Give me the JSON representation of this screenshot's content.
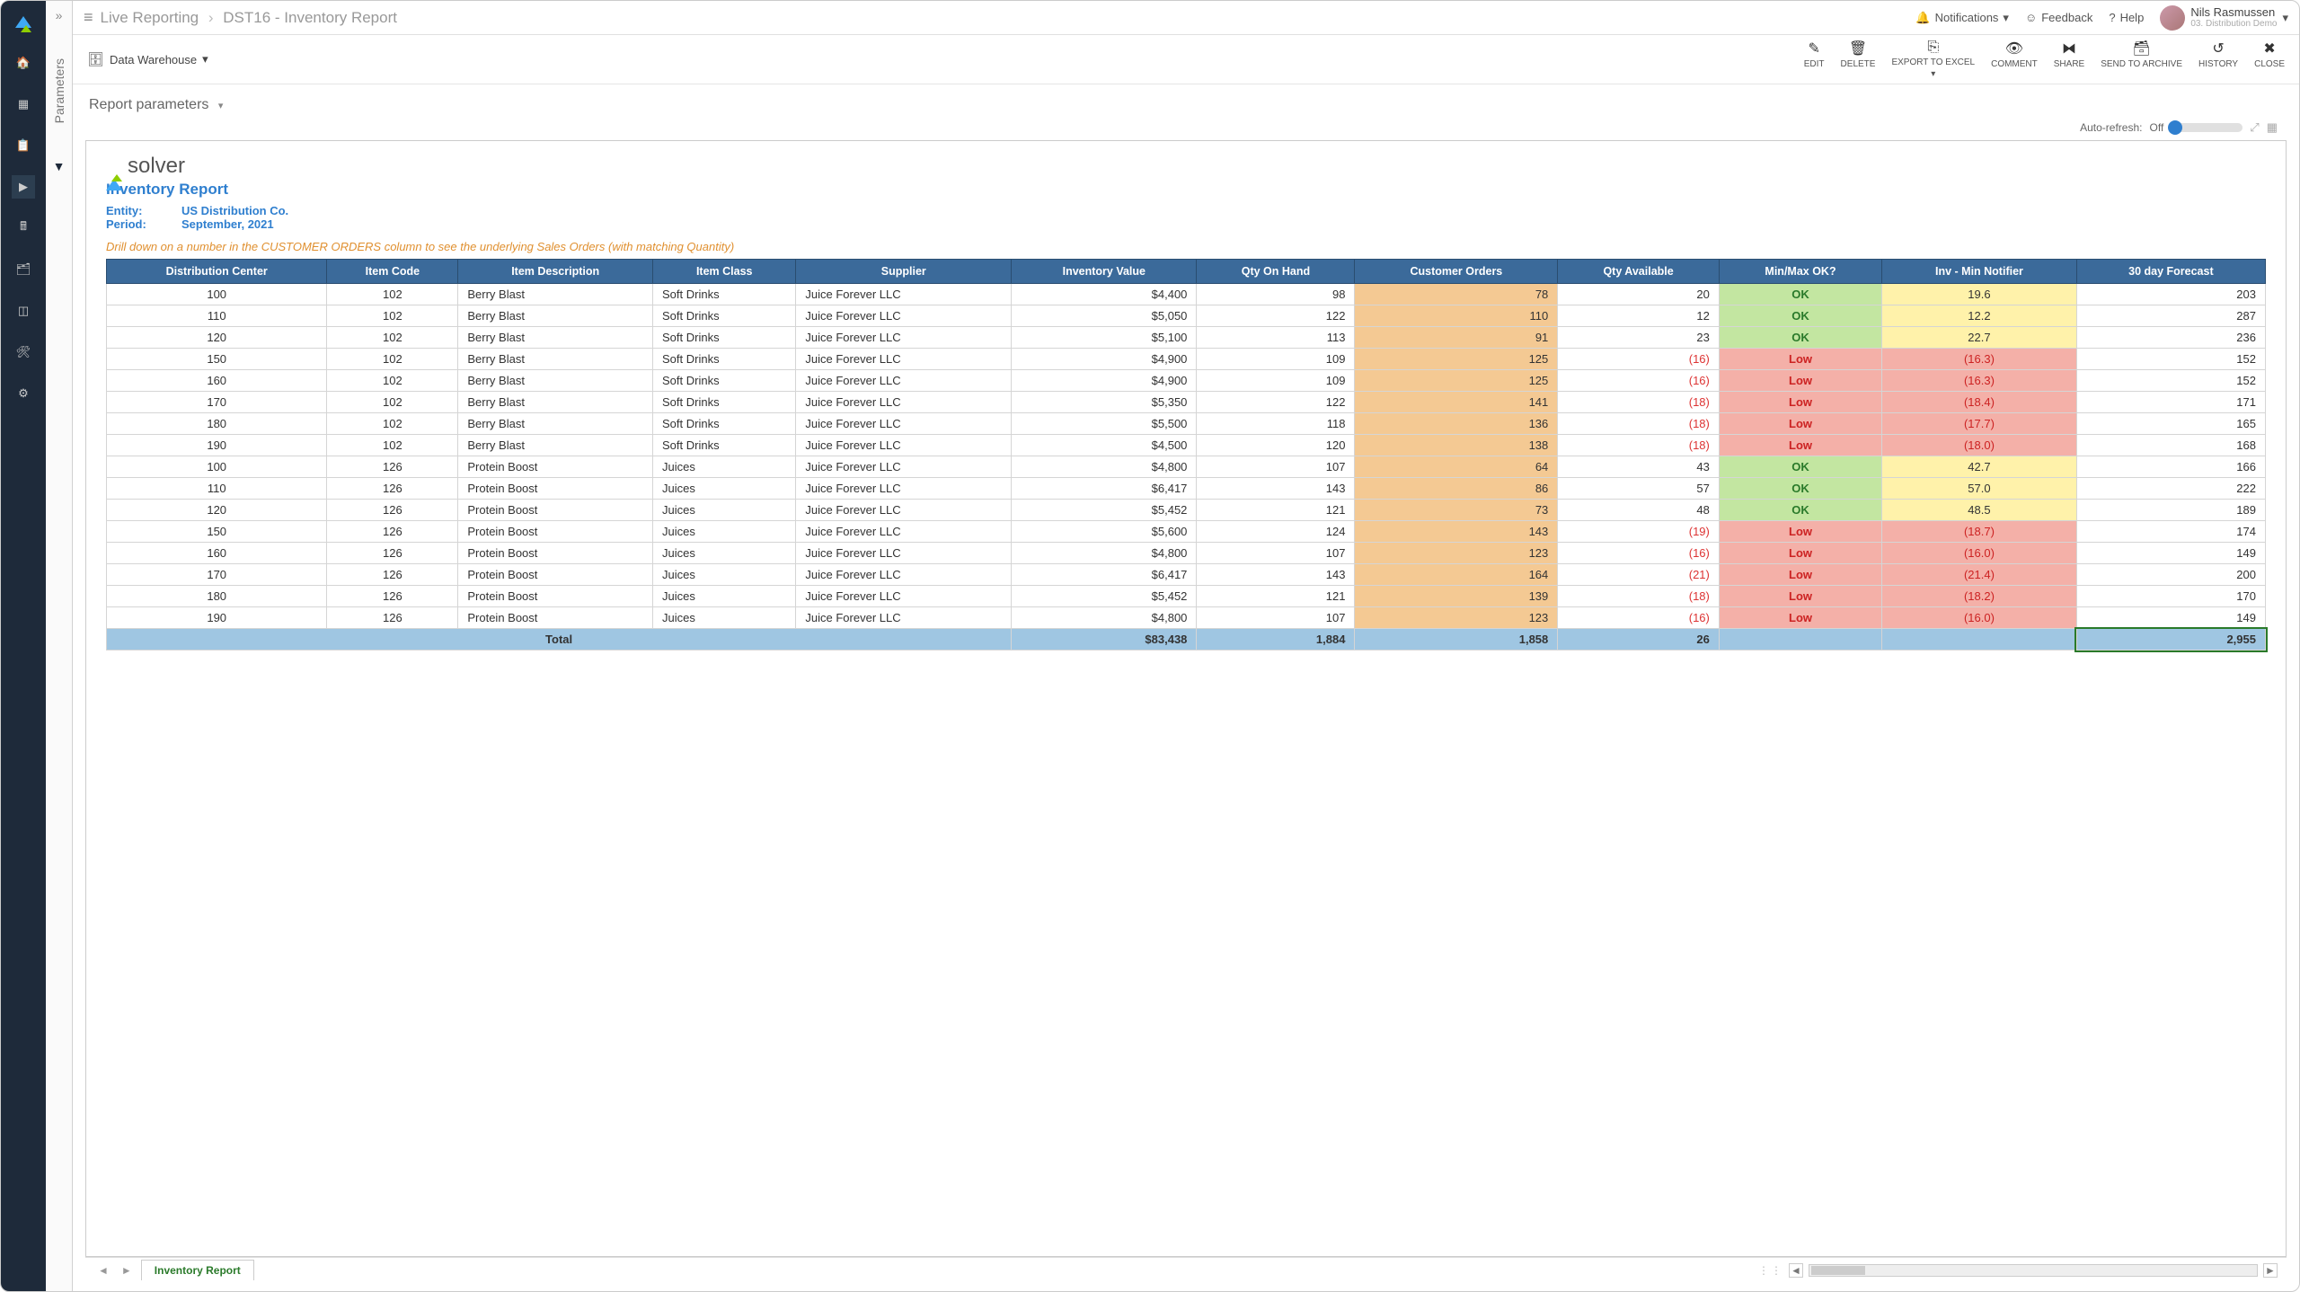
{
  "breadcrumb": {
    "root": "Live Reporting",
    "leaf": "DST16 - Inventory Report"
  },
  "topbar": {
    "notifications": "Notifications",
    "feedback": "Feedback",
    "help": "Help",
    "user_name": "Nils Rasmussen",
    "user_role": "03. Distribution Demo"
  },
  "toolbar": {
    "source": "Data Warehouse",
    "actions": {
      "edit": "EDIT",
      "delete": "DELETE",
      "export": "EXPORT TO EXCEL",
      "comment": "COMMENT",
      "share": "SHARE",
      "archive": "SEND TO ARCHIVE",
      "history": "HISTORY",
      "close": "CLOSE"
    }
  },
  "params_label": "Report parameters",
  "side_panel_label": "Parameters",
  "auto_refresh": {
    "label": "Auto-refresh:",
    "state": "Off"
  },
  "report": {
    "brand": "solver",
    "title": "Inventory Report",
    "entity_label": "Entity:",
    "entity_value": "US Distribution Co.",
    "period_label": "Period:",
    "period_value": "September, 2021",
    "drill_hint": "Drill down on a number in the CUSTOMER ORDERS column to see the underlying Sales Orders (with matching Quantity)",
    "columns": [
      "Distribution Center",
      "Item Code",
      "Item Description",
      "Item Class",
      "Supplier",
      "Inventory Value",
      "Qty On Hand",
      "Customer Orders",
      "Qty Available",
      "Min/Max OK?",
      "Inv - Min Notifier",
      "30 day Forecast"
    ],
    "rows": [
      {
        "dc": "100",
        "code": "102",
        "desc": "Berry Blast",
        "class": "Soft Drinks",
        "supplier": "Juice Forever LLC",
        "inv": "$4,400",
        "onhand": "98",
        "cust": "78",
        "avail": "20",
        "ok": "OK",
        "note": "19.6",
        "note_status": "y",
        "fc": "203"
      },
      {
        "dc": "110",
        "code": "102",
        "desc": "Berry Blast",
        "class": "Soft Drinks",
        "supplier": "Juice Forever LLC",
        "inv": "$5,050",
        "onhand": "122",
        "cust": "110",
        "avail": "12",
        "ok": "OK",
        "note": "12.2",
        "note_status": "y",
        "fc": "287"
      },
      {
        "dc": "120",
        "code": "102",
        "desc": "Berry Blast",
        "class": "Soft Drinks",
        "supplier": "Juice Forever LLC",
        "inv": "$5,100",
        "onhand": "113",
        "cust": "91",
        "avail": "23",
        "ok": "OK",
        "note": "22.7",
        "note_status": "y",
        "fc": "236"
      },
      {
        "dc": "150",
        "code": "102",
        "desc": "Berry Blast",
        "class": "Soft Drinks",
        "supplier": "Juice Forever LLC",
        "inv": "$4,900",
        "onhand": "109",
        "cust": "125",
        "avail": "(16)",
        "ok": "Low",
        "note": "(16.3)",
        "note_status": "r",
        "fc": "152"
      },
      {
        "dc": "160",
        "code": "102",
        "desc": "Berry Blast",
        "class": "Soft Drinks",
        "supplier": "Juice Forever LLC",
        "inv": "$4,900",
        "onhand": "109",
        "cust": "125",
        "avail": "(16)",
        "ok": "Low",
        "note": "(16.3)",
        "note_status": "r",
        "fc": "152"
      },
      {
        "dc": "170",
        "code": "102",
        "desc": "Berry Blast",
        "class": "Soft Drinks",
        "supplier": "Juice Forever LLC",
        "inv": "$5,350",
        "onhand": "122",
        "cust": "141",
        "avail": "(18)",
        "ok": "Low",
        "note": "(18.4)",
        "note_status": "r",
        "fc": "171"
      },
      {
        "dc": "180",
        "code": "102",
        "desc": "Berry Blast",
        "class": "Soft Drinks",
        "supplier": "Juice Forever LLC",
        "inv": "$5,500",
        "onhand": "118",
        "cust": "136",
        "avail": "(18)",
        "ok": "Low",
        "note": "(17.7)",
        "note_status": "r",
        "fc": "165"
      },
      {
        "dc": "190",
        "code": "102",
        "desc": "Berry Blast",
        "class": "Soft Drinks",
        "supplier": "Juice Forever LLC",
        "inv": "$4,500",
        "onhand": "120",
        "cust": "138",
        "avail": "(18)",
        "ok": "Low",
        "note": "(18.0)",
        "note_status": "r",
        "fc": "168"
      },
      {
        "dc": "100",
        "code": "126",
        "desc": "Protein Boost",
        "class": "Juices",
        "supplier": "Juice Forever LLC",
        "inv": "$4,800",
        "onhand": "107",
        "cust": "64",
        "avail": "43",
        "ok": "OK",
        "note": "42.7",
        "note_status": "y",
        "fc": "166"
      },
      {
        "dc": "110",
        "code": "126",
        "desc": "Protein Boost",
        "class": "Juices",
        "supplier": "Juice Forever LLC",
        "inv": "$6,417",
        "onhand": "143",
        "cust": "86",
        "avail": "57",
        "ok": "OK",
        "note": "57.0",
        "note_status": "y",
        "fc": "222"
      },
      {
        "dc": "120",
        "code": "126",
        "desc": "Protein Boost",
        "class": "Juices",
        "supplier": "Juice Forever LLC",
        "inv": "$5,452",
        "onhand": "121",
        "cust": "73",
        "avail": "48",
        "ok": "OK",
        "note": "48.5",
        "note_status": "y",
        "fc": "189"
      },
      {
        "dc": "150",
        "code": "126",
        "desc": "Protein Boost",
        "class": "Juices",
        "supplier": "Juice Forever LLC",
        "inv": "$5,600",
        "onhand": "124",
        "cust": "143",
        "avail": "(19)",
        "ok": "Low",
        "note": "(18.7)",
        "note_status": "r",
        "fc": "174"
      },
      {
        "dc": "160",
        "code": "126",
        "desc": "Protein Boost",
        "class": "Juices",
        "supplier": "Juice Forever LLC",
        "inv": "$4,800",
        "onhand": "107",
        "cust": "123",
        "avail": "(16)",
        "ok": "Low",
        "note": "(16.0)",
        "note_status": "r",
        "fc": "149"
      },
      {
        "dc": "170",
        "code": "126",
        "desc": "Protein Boost",
        "class": "Juices",
        "supplier": "Juice Forever LLC",
        "inv": "$6,417",
        "onhand": "143",
        "cust": "164",
        "avail": "(21)",
        "ok": "Low",
        "note": "(21.4)",
        "note_status": "r",
        "fc": "200"
      },
      {
        "dc": "180",
        "code": "126",
        "desc": "Protein Boost",
        "class": "Juices",
        "supplier": "Juice Forever LLC",
        "inv": "$5,452",
        "onhand": "121",
        "cust": "139",
        "avail": "(18)",
        "ok": "Low",
        "note": "(18.2)",
        "note_status": "r",
        "fc": "170"
      },
      {
        "dc": "190",
        "code": "126",
        "desc": "Protein Boost",
        "class": "Juices",
        "supplier": "Juice Forever LLC",
        "inv": "$4,800",
        "onhand": "107",
        "cust": "123",
        "avail": "(16)",
        "ok": "Low",
        "note": "(16.0)",
        "note_status": "r",
        "fc": "149"
      }
    ],
    "total": {
      "label": "Total",
      "inv": "$83,438",
      "onhand": "1,884",
      "cust": "1,858",
      "avail": "26",
      "fc": "2,955"
    }
  },
  "sheet_tab": "Inventory Report"
}
